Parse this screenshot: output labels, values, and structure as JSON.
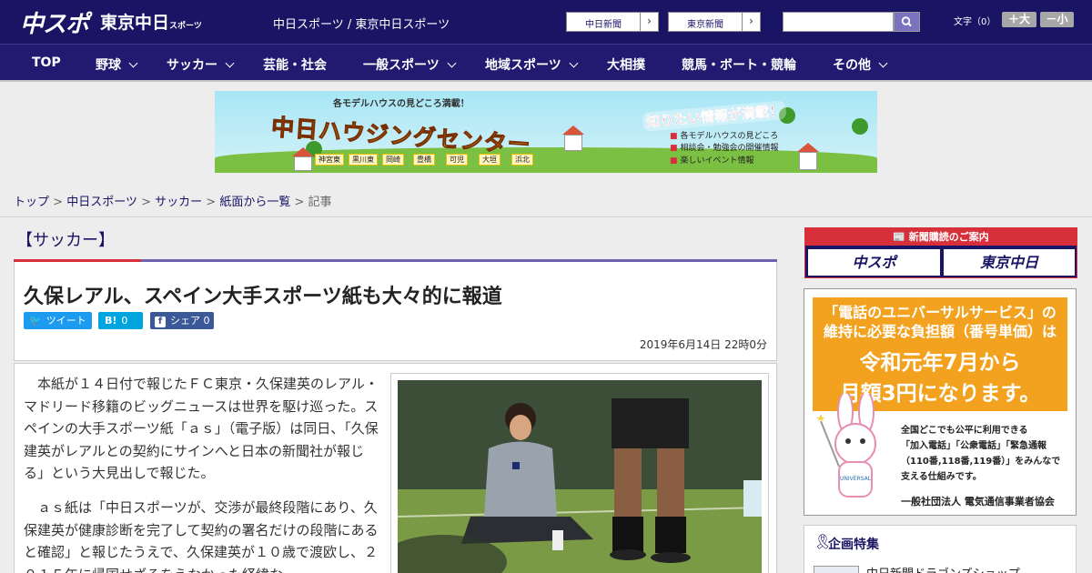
{
  "header": {
    "logo_main": "中スポ",
    "logo_sub": "東京中日",
    "logo_sub_small": "スポーツ",
    "site_names": "中日スポーツ / 東京中日スポーツ",
    "ext_link_1": "中日新聞",
    "ext_link_2": "東京新聞",
    "search_placeholder": "",
    "fontsize_label": "文字（0）",
    "font_larger": "＋大",
    "font_smaller": "－小"
  },
  "nav": {
    "items": [
      "TOP",
      "野球",
      "サッカー",
      "芸能・社会",
      "一般スポーツ",
      "地域スポーツ",
      "大相撲",
      "競馬・ボート・競輪",
      "その他"
    ]
  },
  "banner": {
    "top_text": "各モデルハウスの見どころ満載！",
    "title": "中日ハウジングセンター",
    "right_title": "知りたい情報が満載！",
    "info": [
      "各モデルハウスの見どころ",
      "相談会・勉強会の開催情報",
      "楽しいイベント情報"
    ],
    "cities": [
      "神宮東",
      "黒川東",
      "岡崎",
      "豊橋",
      "可児",
      "大垣",
      "浜北"
    ]
  },
  "breadcrumb": {
    "items": [
      "トップ",
      "中日スポーツ",
      "サッカー",
      "紙面から一覧"
    ],
    "current": "記事",
    "separator": ">"
  },
  "article": {
    "category": "【サッカー】",
    "title": "久保レアル、スペイン大手スポーツ紙も大々的に報道",
    "share_tweet": "ツイート",
    "share_hatena": "0",
    "share_facebook": "シェア",
    "share_facebook_count": "0",
    "date": "2019年6月14日 22時0分",
    "paragraphs": [
      "本紙が１４日付で報じたＦＣ東京・久保建英のレアル・マドリード移籍のビッグニュースは世界を駆け巡った。スペインの大手スポーツ紙「ａｓ」（電子版）は同日、「久保建英がレアルとの契約にサインへと日本の新聞社が報じる」という大見出しで報じた。",
      "ａｓ紙は「中日スポーツが、交渉が最終段階にあり、久保建英が健康診断を完了して契約の署名だけの段階にあると確認」と報じたうえで、久保建英が１０歳で渡欧し、２０１５年に帰国せざるをえなかった経緯な"
    ]
  },
  "sidebar": {
    "subscribe_head": "新聞購読のご案内",
    "subscribe_btn_1": "中スポ",
    "subscribe_btn_2": "東京中日",
    "ad_line1": "「電話のユニバーサルサービス」の",
    "ad_line2": "維持に必要な負担額（番号単価）は",
    "ad_big1": "令和元年7月から",
    "ad_big2": "月額3円になります。",
    "ad_small": [
      "全国どこでも公平に利用できる",
      "「加入電話」「公衆電話」「緊急通報",
      "（110番,118番,119番）」をみんなで",
      "支える仕組みです。"
    ],
    "ad_org": "一般社団法人 電気通信事業者協会",
    "feature_title": "企画特集",
    "feature_item": "中日新聞ドラゴンズショップ"
  },
  "colors": {
    "header_bg": "#1a1464",
    "nav_bg": "#211a70",
    "accent_red": "#d7303a",
    "twitter": "#1d9bf0",
    "hatena": "#00a4de",
    "facebook": "#3b5998",
    "ad_orange": "#f3a21f"
  }
}
